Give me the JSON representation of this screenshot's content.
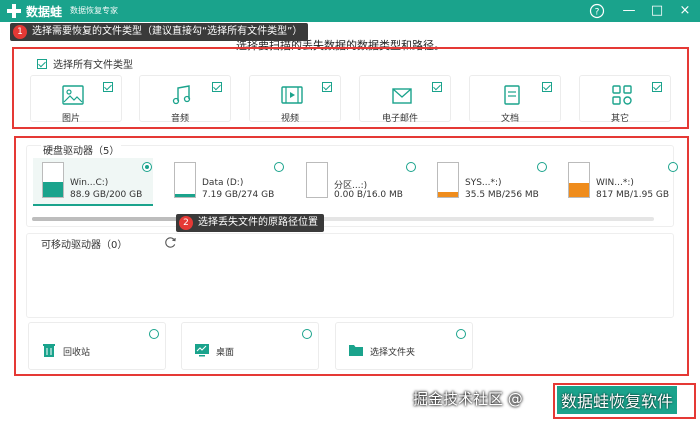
{
  "app": {
    "name": "数据蛙",
    "subtitle": "数据恢复专家",
    "brand_color": "#1aa38c"
  },
  "window_controls": {
    "help": "?",
    "minimize": "—",
    "maximize": "□",
    "close": "×"
  },
  "callouts": [
    {
      "num": "1",
      "text": "选择需要恢复的文件类型（建议直接勾“选择所有文件类型”）"
    },
    {
      "num": "2",
      "text": "选择丢失文件的原路径位置"
    }
  ],
  "instruction": "选择要扫描的丢失数据的数据类型和路径。",
  "file_types": {
    "select_all_label": "选择所有文件类型",
    "select_all_checked": true,
    "items": [
      {
        "label": "图片",
        "icon": "image-icon",
        "checked": true
      },
      {
        "label": "音频",
        "icon": "music-icon",
        "checked": true
      },
      {
        "label": "视频",
        "icon": "video-icon",
        "checked": true
      },
      {
        "label": "电子邮件",
        "icon": "mail-icon",
        "checked": true
      },
      {
        "label": "文档",
        "icon": "document-icon",
        "checked": true
      },
      {
        "label": "其它",
        "icon": "other-icon",
        "checked": true
      }
    ]
  },
  "drives": {
    "header": "硬盘驱动器（5）",
    "items": [
      {
        "name": "Win...C:)",
        "size": "88.9 GB/200 GB",
        "used_fraction": 0.44,
        "color": "#1aa38c",
        "selected": true
      },
      {
        "name": "Data (D:)",
        "size": "7.19 GB/274 GB",
        "used_fraction": 0.03,
        "color": "#1aa38c",
        "selected": false
      },
      {
        "name": "分区...:)",
        "size": "0.00  B/16.0 MB",
        "used_fraction": 0.0,
        "color": "#1aa38c",
        "selected": false
      },
      {
        "name": "SYS...*:)",
        "size": "35.5 MB/256 MB",
        "used_fraction": 0.14,
        "color": "#ef8c1c",
        "selected": false
      },
      {
        "name": "WIN...*:)",
        "size": "817 MB/1.95 GB",
        "used_fraction": 0.42,
        "color": "#ef8c1c",
        "selected": false
      }
    ]
  },
  "removable": {
    "header": "可移动驱动器（0）"
  },
  "locations": [
    {
      "label": "回收站",
      "icon": "recycle-bin-icon"
    },
    {
      "label": "桌面",
      "icon": "desktop-icon"
    },
    {
      "label": "选择文件夹",
      "icon": "folder-icon"
    }
  ],
  "watermark": {
    "text": "掘金技术社区 @",
    "brand": "数据蛙恢复软件"
  }
}
